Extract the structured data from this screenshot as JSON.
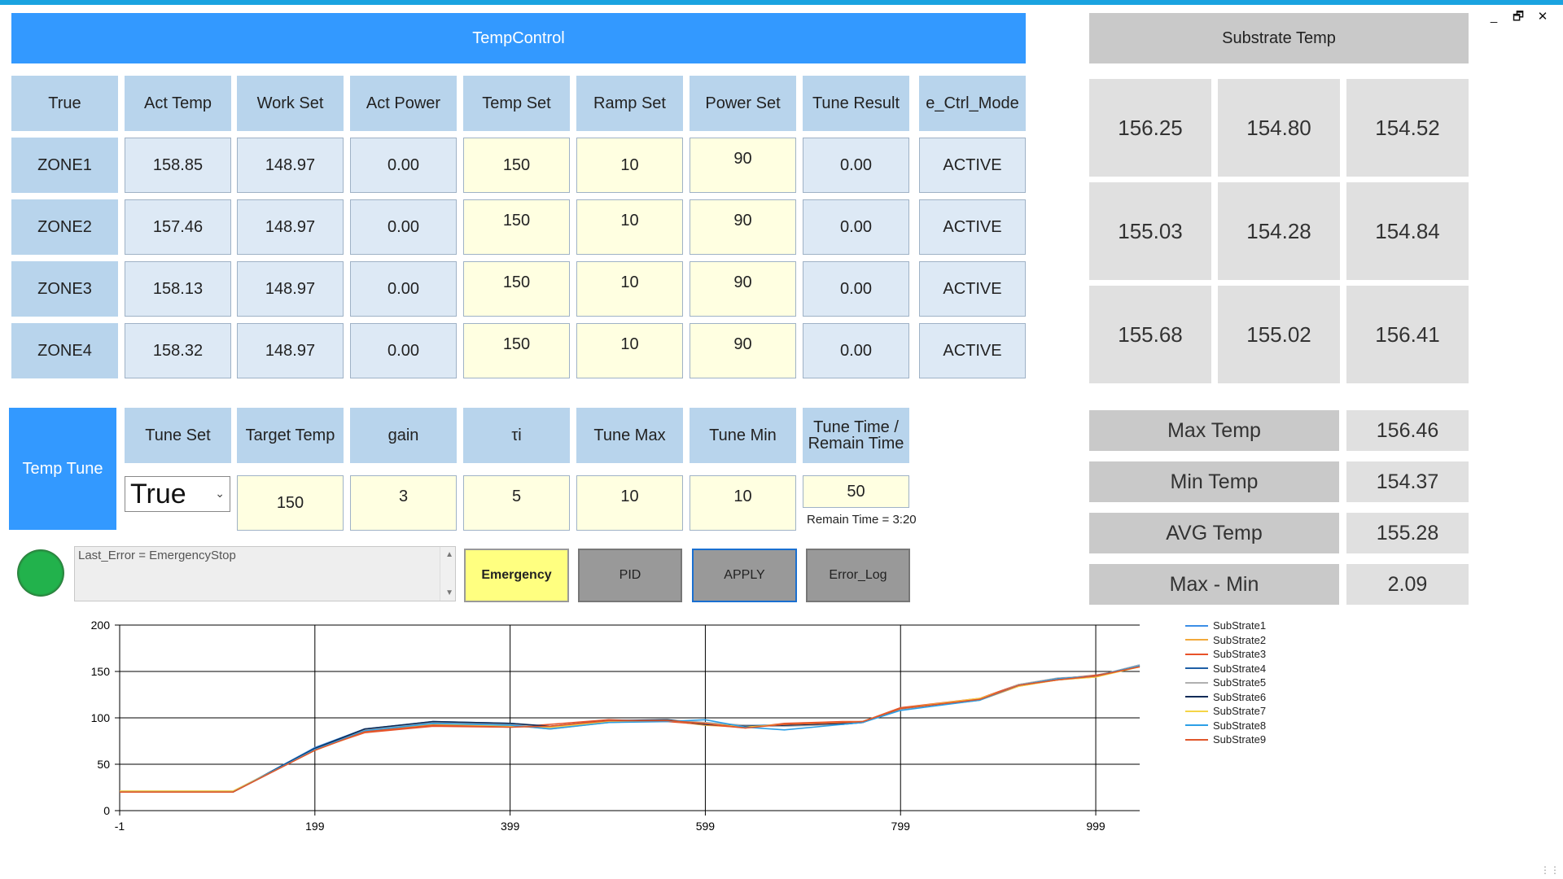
{
  "window": {
    "minimize": "_",
    "restore": "🗗",
    "close": "✕"
  },
  "temp_control": {
    "title": "TempControl",
    "headers": [
      "True",
      "Act Temp",
      "Work Set",
      "Act Power",
      "Temp Set",
      "Ramp Set",
      "Power Set",
      "Tune Result",
      "e_Ctrl_Mode"
    ],
    "rows": [
      {
        "zone": "ZONE1",
        "act_temp": "158.85",
        "work_set": "148.97",
        "act_power": "0.00",
        "temp_set": "150",
        "ramp_set": "10",
        "power_set": "90",
        "tune_result": "0.00",
        "ctrl_mode": "ACTIVE"
      },
      {
        "zone": "ZONE2",
        "act_temp": "157.46",
        "work_set": "148.97",
        "act_power": "0.00",
        "temp_set": "150",
        "ramp_set": "10",
        "power_set": "90",
        "tune_result": "0.00",
        "ctrl_mode": "ACTIVE"
      },
      {
        "zone": "ZONE3",
        "act_temp": "158.13",
        "work_set": "148.97",
        "act_power": "0.00",
        "temp_set": "150",
        "ramp_set": "10",
        "power_set": "90",
        "tune_result": "0.00",
        "ctrl_mode": "ACTIVE"
      },
      {
        "zone": "ZONE4",
        "act_temp": "158.32",
        "work_set": "148.97",
        "act_power": "0.00",
        "temp_set": "150",
        "ramp_set": "10",
        "power_set": "90",
        "tune_result": "0.00",
        "ctrl_mode": "ACTIVE"
      }
    ]
  },
  "temp_tune": {
    "title": "Temp Tune",
    "headers": [
      "Tune Set",
      "Target Temp",
      "gain",
      "τi",
      "Tune Max",
      "Tune Min",
      "Tune Time /\nRemain Time"
    ],
    "tune_set_value": "True",
    "target_temp": "150",
    "gain": "3",
    "ti": "5",
    "tune_max": "10",
    "tune_min": "10",
    "tune_time": "50",
    "remain_time": "Remain Time = 3:20"
  },
  "log": {
    "text": "Last_Error = EmergencyStop"
  },
  "buttons": {
    "emergency": "Emergency",
    "pid": "PID",
    "apply": "APPLY",
    "error_log": "Error_Log"
  },
  "substrate": {
    "title": "Substrate Temp",
    "values": [
      "156.25",
      "154.80",
      "154.52",
      "155.03",
      "154.28",
      "154.84",
      "155.68",
      "155.02",
      "156.41"
    ],
    "stats": [
      {
        "label": "Max Temp",
        "value": "156.46"
      },
      {
        "label": "Min Temp",
        "value": "154.37"
      },
      {
        "label": "AVG Temp",
        "value": "155.28"
      },
      {
        "label": "Max - Min",
        "value": "2.09"
      }
    ]
  },
  "colors": {
    "accent": "#3399ff",
    "header": "#b8d4ec",
    "input": "#ffffe1",
    "emergency": "#ffff80",
    "led": "#22b24c"
  },
  "chart_data": {
    "type": "line",
    "x_ticks": [
      "-1",
      "199",
      "399",
      "599",
      "799",
      "999"
    ],
    "y_ticks": [
      "0",
      "50",
      "100",
      "150",
      "200"
    ],
    "xlim": [
      -1,
      1044
    ],
    "ylim": [
      0,
      200
    ],
    "grid": true,
    "legend_position": "right",
    "x": [
      -1,
      115,
      199,
      250,
      320,
      400,
      440,
      500,
      560,
      599,
      640,
      680,
      740,
      760,
      799,
      880,
      920,
      960,
      999,
      1044
    ],
    "series": [
      {
        "name": "SubStrate1",
        "color": "#3c8ee6",
        "values": [
          20,
          20,
          68,
          88,
          96,
          94,
          90,
          96,
          98,
          93,
          92,
          92,
          93,
          96,
          110,
          120,
          135,
          142,
          145,
          157
        ]
      },
      {
        "name": "SubStrate2",
        "color": "#f2a93b",
        "values": [
          21,
          21,
          65,
          86,
          94,
          92,
          88,
          95,
          97,
          92,
          90,
          93,
          94,
          95,
          109,
          119,
          134,
          141,
          144,
          156
        ]
      },
      {
        "name": "SubStrate3",
        "color": "#e8522a",
        "values": [
          20,
          20,
          66,
          84,
          91,
          90,
          93,
          98,
          96,
          93,
          89,
          94,
          96,
          96,
          111,
          121,
          136,
          142,
          146,
          155
        ]
      },
      {
        "name": "SubStrate4",
        "color": "#1f5fa6",
        "values": [
          20,
          20,
          67,
          87,
          95,
          93,
          89,
          96,
          97,
          94,
          91,
          92,
          93,
          95,
          110,
          120,
          135,
          141,
          145,
          156
        ]
      },
      {
        "name": "SubStrate5",
        "color": "#b0b0b0",
        "values": [
          21,
          21,
          66,
          87,
          95,
          93,
          89,
          95,
          98,
          95,
          92,
          91,
          93,
          96,
          109,
          119,
          136,
          143,
          145,
          157
        ]
      },
      {
        "name": "SubStrate6",
        "color": "#0d2b57",
        "values": [
          20,
          20,
          67,
          88,
          96,
          94,
          91,
          97,
          98,
          93,
          91,
          92,
          94,
          95,
          110,
          120,
          135,
          142,
          145,
          156
        ]
      },
      {
        "name": "SubStrate7",
        "color": "#f5d547",
        "values": [
          21,
          21,
          65,
          85,
          93,
          91,
          90,
          96,
          97,
          94,
          90,
          93,
          95,
          96,
          110,
          121,
          134,
          141,
          144,
          155
        ]
      },
      {
        "name": "SubStrate8",
        "color": "#2c9fe6",
        "values": [
          20,
          20,
          66,
          86,
          94,
          92,
          88,
          95,
          96,
          98,
          90,
          87,
          93,
          95,
          108,
          119,
          135,
          142,
          145,
          156
        ]
      },
      {
        "name": "SubStrate9",
        "color": "#e0562a",
        "values": [
          20,
          20,
          65,
          85,
          92,
          90,
          91,
          97,
          97,
          94,
          89,
          93,
          95,
          96,
          110,
          120,
          135,
          141,
          145,
          155
        ]
      }
    ]
  }
}
